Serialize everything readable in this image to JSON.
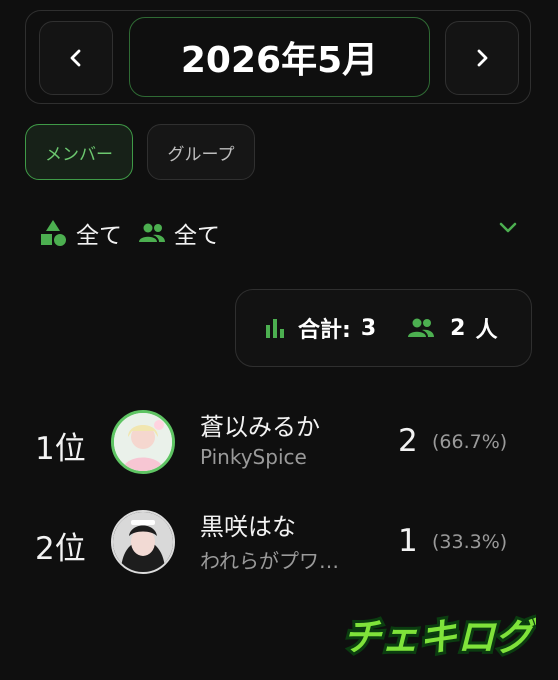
{
  "header": {
    "month_label": "2026年5月",
    "prev_icon": "chevron-left-icon",
    "next_icon": "chevron-right-icon"
  },
  "tabs": [
    {
      "label": "メンバー",
      "active": true
    },
    {
      "label": "グループ",
      "active": false
    }
  ],
  "filters": {
    "category_label": "全て",
    "people_label": "全て"
  },
  "summary": {
    "total_label": "合計:",
    "total_value": "3",
    "people_value": "2",
    "people_unit": "人"
  },
  "ranking": [
    {
      "rank": "1位",
      "name": "蒼以みるか",
      "group": "PinkySpice",
      "count": "2",
      "percent": "(66.7%)"
    },
    {
      "rank": "2位",
      "name": "黒咲はな",
      "group": "われらがプワ…",
      "count": "1",
      "percent": "(33.3%)"
    }
  ],
  "logo": {
    "text": "チェキログ"
  },
  "colors": {
    "accent": "#4caf50",
    "background": "#0f0f0f",
    "muted": "#9a9a9a"
  }
}
